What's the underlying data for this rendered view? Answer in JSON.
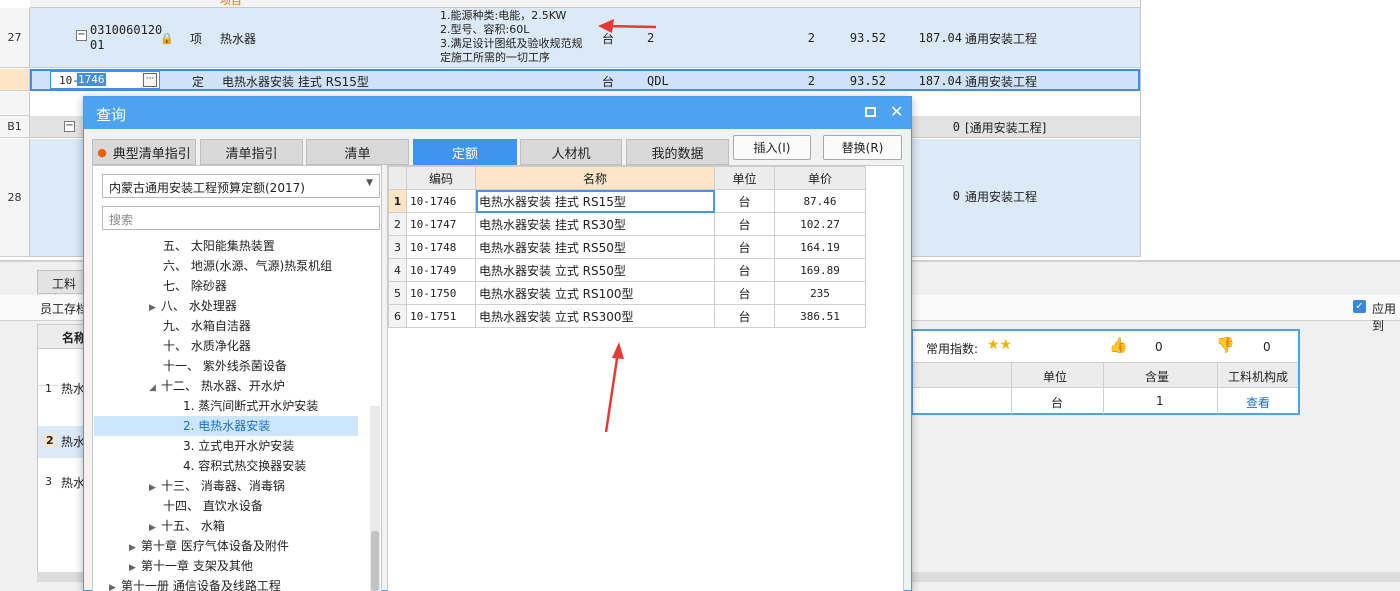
{
  "rows_top": {
    "r27": {
      "rownum": "27",
      "code_line1": "0310060120",
      "code_line2": "01",
      "type": "项",
      "name": "热水器",
      "features": [
        "1.能源种类:电能，2.5KW",
        "2.型号、容积:60L",
        "3.满足设计图纸及验收规范规",
        "定施工所需的一切工序"
      ],
      "unit": "台",
      "qty_expr": "2",
      "qty": "2",
      "price": "93.52",
      "total": "187.04",
      "category": "通用安装工程"
    },
    "sub": {
      "code_prefix": "10-",
      "code_selected": "1746",
      "type": "定",
      "name": "电热水器安装 挂式 RS15型",
      "unit": "台",
      "qty_expr": "QDL",
      "qty": "2",
      "price": "93.52",
      "total": "187.04",
      "category": "通用安装工程"
    },
    "b1": {
      "rownum": "B1",
      "total": "0",
      "category": "[通用安装工程]"
    },
    "r28": {
      "rownum": "28",
      "total": "0",
      "category": "通用安装工程"
    },
    "header_partial": "项目"
  },
  "bottom": {
    "tab_partial": "工料机",
    "sub_partial": "员工存档",
    "col_partial": "名称",
    "rows": [
      {
        "num": "1",
        "text": "热水"
      },
      {
        "num": "2",
        "text": "热水"
      },
      {
        "num": "3",
        "text": "热水"
      }
    ],
    "apply_checkbox_label": "应用到",
    "info": {
      "freq_label": "常用指数:",
      "like_count": "0",
      "dislike_count": "0",
      "headers": [
        "单位",
        "含量",
        "工料机构成"
      ],
      "row": {
        "unit": "台",
        "content": "1",
        "link": "查看"
      }
    }
  },
  "dialog": {
    "title": "查询",
    "tabs": [
      "典型清单指引",
      "清单指引",
      "清单",
      "定额",
      "人材机",
      "我的数据"
    ],
    "active_tab": "定额",
    "insert_button": "插入(I)",
    "replace_button": "替换(R)",
    "quota_book": "内蒙古通用安装工程预算定额(2017)",
    "search_placeholder": "搜索",
    "tree": [
      "五、 太阳能集热装置",
      "六、 地源(水源、气源)热泵机组",
      "七、 除砂器",
      "八、 水处理器",
      "九、 水箱自洁器",
      "十、 水质净化器",
      "十一、 紫外线杀菌设备",
      "十二、 热水器、开水炉",
      "1. 蒸汽间断式开水炉安装",
      "2. 电热水器安装",
      "3. 立式电开水炉安装",
      "4. 容积式热交换器安装",
      "十三、 消毒器、消毒锅",
      "十四、 直饮水设备",
      "十五、 水箱",
      "第十章 医疗气体设备及附件",
      "第十一章 支架及其他",
      "第十一册 通信设备及线路工程"
    ],
    "table": {
      "headers": [
        "编码",
        "名称",
        "单位",
        "单价"
      ],
      "rows": [
        {
          "num": "1",
          "code": "10-1746",
          "name": "电热水器安装 挂式 RS15型",
          "unit": "台",
          "price": "87.46"
        },
        {
          "num": "2",
          "code": "10-1747",
          "name": "电热水器安装 挂式 RS30型",
          "unit": "台",
          "price": "102.27"
        },
        {
          "num": "3",
          "code": "10-1748",
          "name": "电热水器安装 挂式 RS50型",
          "unit": "台",
          "price": "164.19"
        },
        {
          "num": "4",
          "code": "10-1749",
          "name": "电热水器安装 立式 RS50型",
          "unit": "台",
          "price": "169.89"
        },
        {
          "num": "5",
          "code": "10-1750",
          "name": "电热水器安装 立式 RS100型",
          "unit": "台",
          "price": "235"
        },
        {
          "num": "6",
          "code": "10-1751",
          "name": "电热水器安装 立式 RS300型",
          "unit": "台",
          "price": "386.51"
        }
      ]
    }
  },
  "colors": {
    "accent": "#4da3f0",
    "selected_row": "#dce9f7",
    "annotation_arrow": "#e53935",
    "header_highlight": "#fde5c5"
  }
}
